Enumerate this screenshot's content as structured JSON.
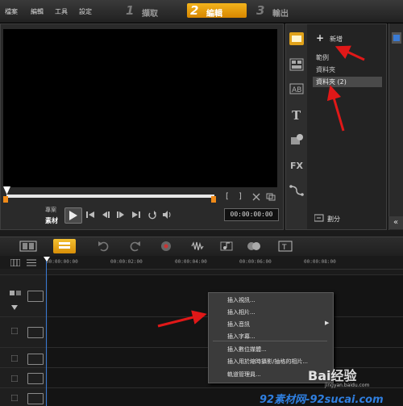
{
  "menu": {
    "file": "檔案",
    "edit": "編輯",
    "tools": "工具",
    "settings": "設定"
  },
  "steps": [
    {
      "num": "1",
      "label": "擷取"
    },
    {
      "num": "2",
      "label": "編輯"
    },
    {
      "num": "3",
      "label": "輸出"
    }
  ],
  "preview": {
    "project_label": "專案",
    "clip_label": "素材",
    "timecode": "00:00:00:00",
    "bracket_in": "[",
    "bracket_out": "]"
  },
  "library": {
    "add_icon": "+",
    "add_label": "新增",
    "items": [
      "範例",
      "資料夾",
      "資料夾 (2)"
    ],
    "sort_label": "劃分",
    "collapse_icon": "«"
  },
  "ruler": {
    "ticks": [
      "00:00:00:00",
      "00:00:02:00",
      "00:00:04:00",
      "00:00:06:00",
      "00:00:08:00"
    ]
  },
  "context_menu": {
    "items": [
      "插入視訊...",
      "插入相片...",
      "插入音訊",
      "插入字幕...",
      "插入數位媒體...",
      "插入用於縮時攝影/抽格的相片...",
      "軌道管理員..."
    ],
    "submenu_arrow": "▶"
  },
  "watermark": {
    "baidu": "Bai经验",
    "baidu_url": "jingyan.baidu.com",
    "bottom": "92素材网-92sucai.com"
  },
  "colors": {
    "accent_orange": "#e49a0c",
    "annotation_red": "#e01818",
    "playhead_blue": "#3a7bd5"
  }
}
